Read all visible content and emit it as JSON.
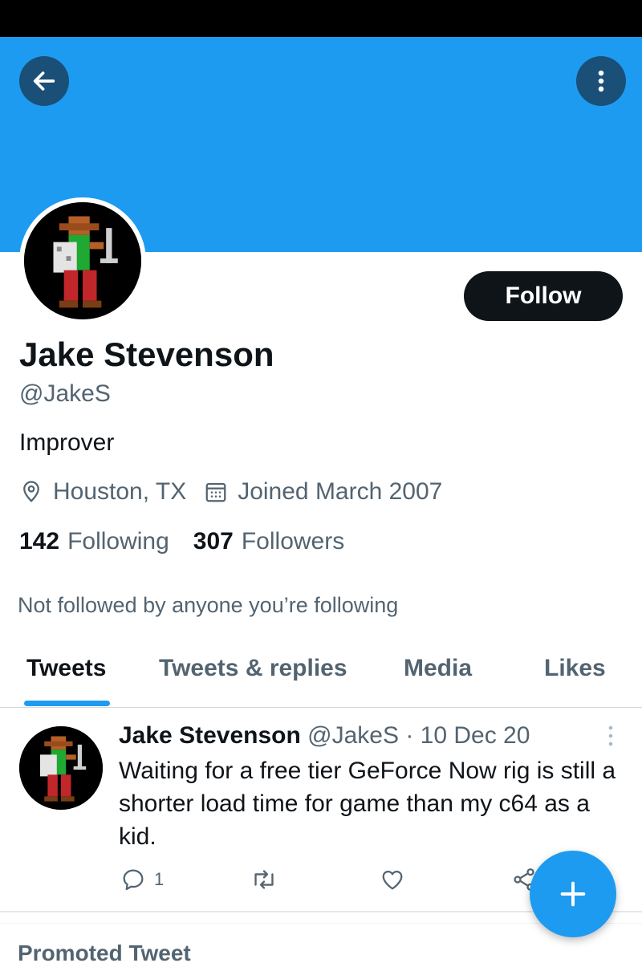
{
  "colors": {
    "brand": "#1d9bf0",
    "text_primary": "#0f1419",
    "text_secondary": "#536471",
    "nav_button_bg": "#1a4f78"
  },
  "header": {
    "back_icon": "arrow-left-icon",
    "more_icon": "more-vertical-icon"
  },
  "profile": {
    "follow_label": "Follow",
    "name": "Jake Stevenson",
    "handle": "@JakeS",
    "bio": "Improver",
    "location": "Houston, TX",
    "joined": "Joined March 2007",
    "following_count": "142",
    "following_label": "Following",
    "followers_count": "307",
    "followers_label": "Followers",
    "not_followed": "Not followed by anyone you’re following"
  },
  "tabs": [
    {
      "label": "Tweets",
      "active": true
    },
    {
      "label": "Tweets & replies",
      "active": false
    },
    {
      "label": "Media",
      "active": false
    },
    {
      "label": "Likes",
      "active": false
    }
  ],
  "tweet": {
    "author": "Jake Stevenson",
    "handle": "@JakeS",
    "separator": "·",
    "date": "10 Dec 20",
    "text": "Waiting for a free tier GeForce Now rig is still a shorter load time for game than my c64 as a kid.",
    "reply_count": "1"
  },
  "promoted_label": "Promoted Tweet",
  "fab_icon": "plus-icon"
}
